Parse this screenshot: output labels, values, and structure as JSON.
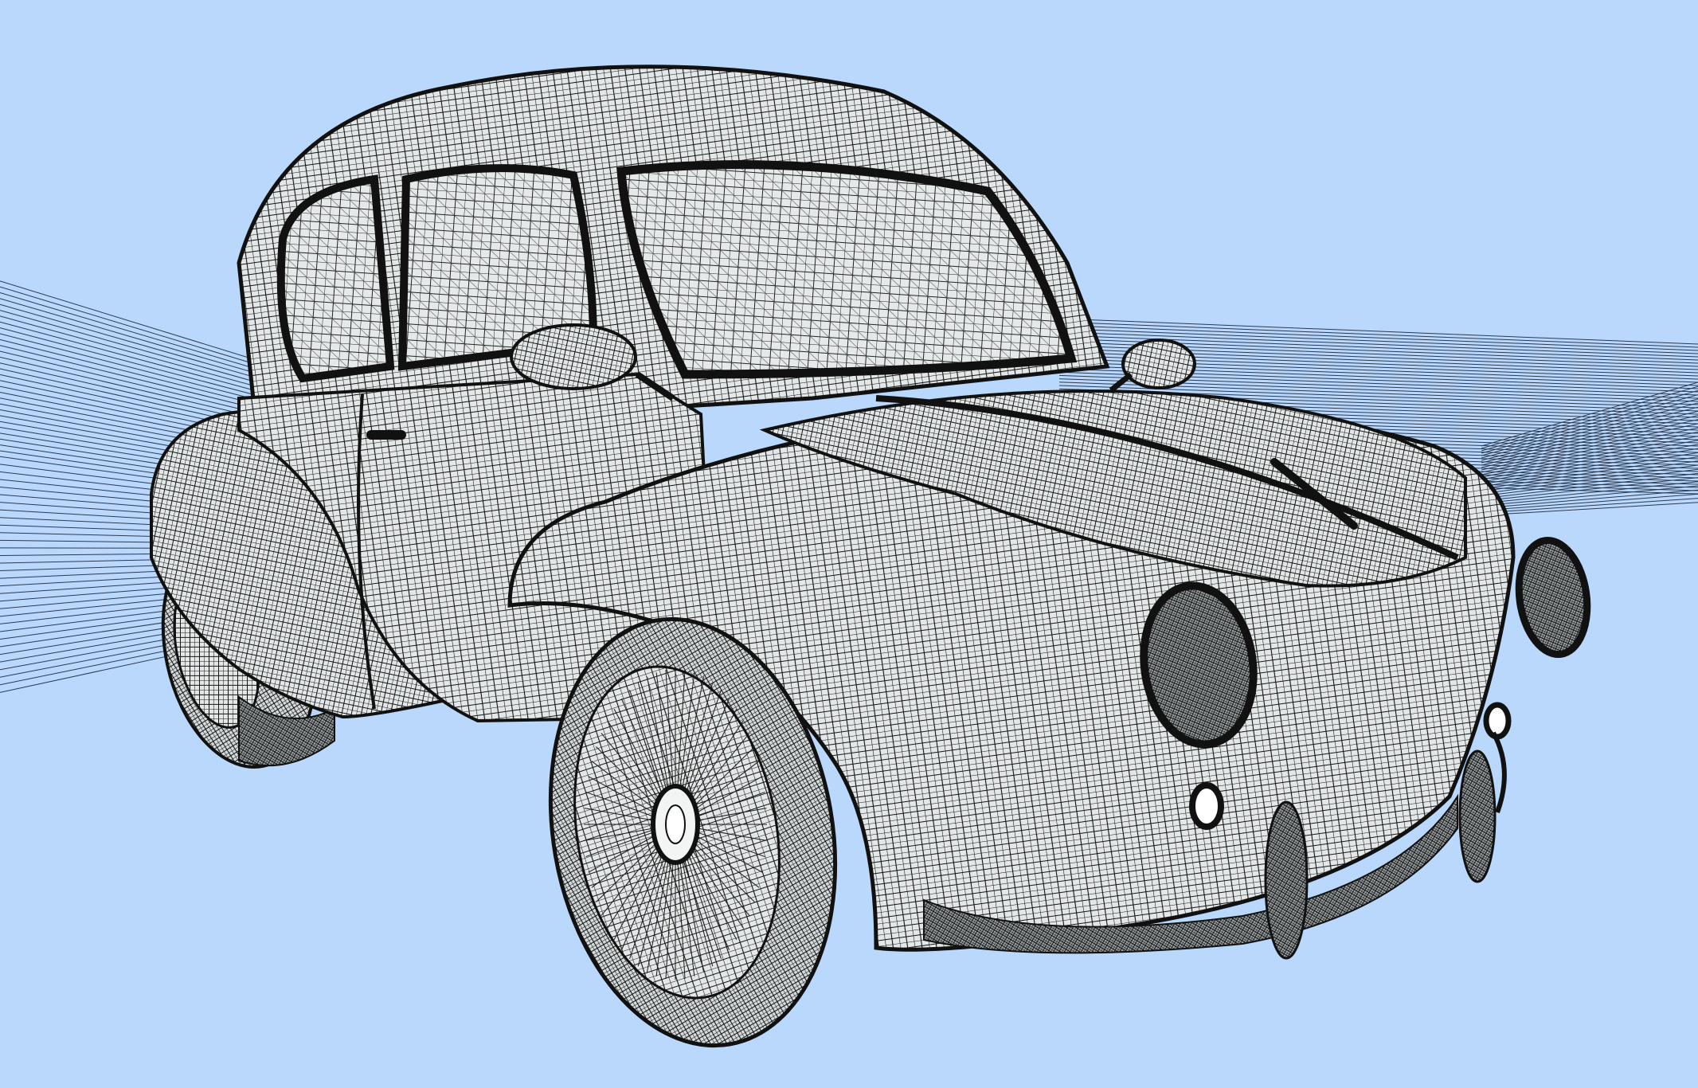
{
  "scene": {
    "subject": "wireframe-mesh-car",
    "background_color": "#bad8fc",
    "surface_color": "#e3e7e7",
    "mesh_line_color": "#141414",
    "streamline_color": "#2a3a52"
  }
}
